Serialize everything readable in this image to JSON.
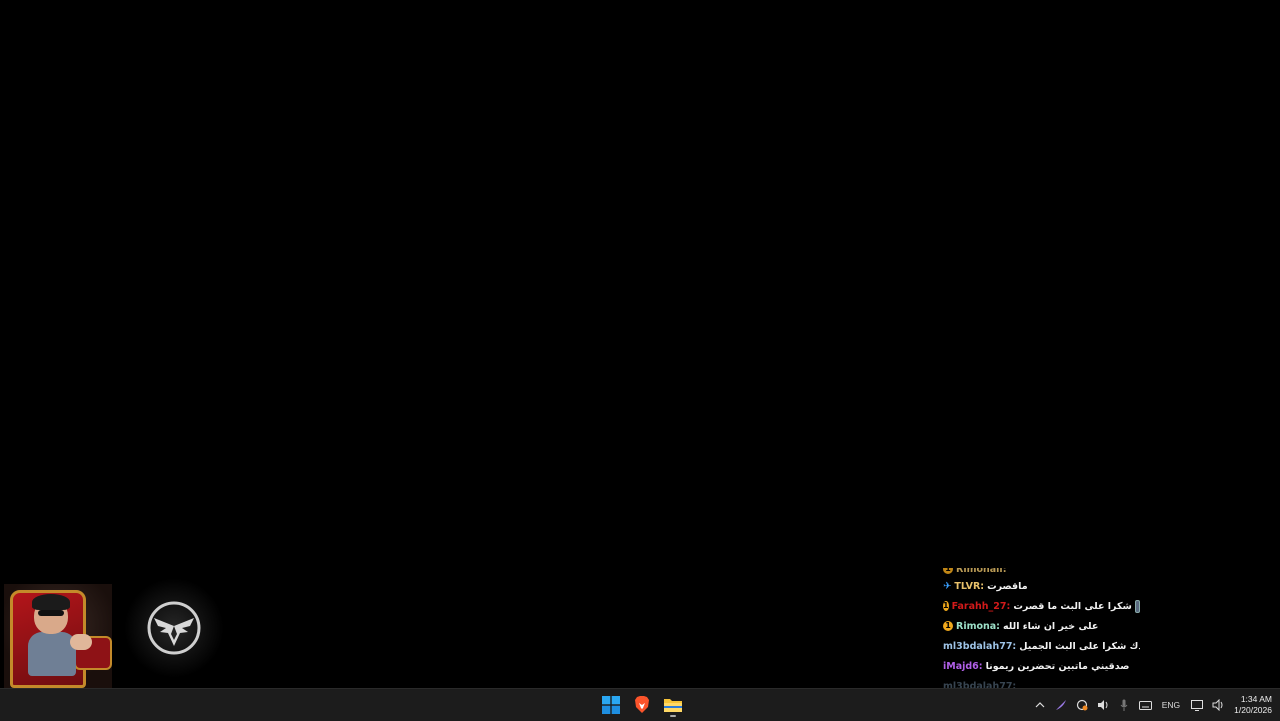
{
  "chat": {
    "messages": [
      {
        "user": "Rimonaاا:",
        "text": "",
        "color": "#e8c16b",
        "badge": "sub",
        "cut": true
      },
      {
        "user": "TLVR:",
        "text": "ماقصرت",
        "color": "#e8c16b",
        "badge": "pin"
      },
      {
        "user": "Farahh_27:",
        "text": "شكرا على البث ما قصرت",
        "color": "#d21a1a",
        "badge": "sub",
        "emote": true
      },
      {
        "user": "Rimona:",
        "text": "على خير ان شاء الله",
        "color": "#9de0c8",
        "badge": "sub"
      },
      {
        "user": "ml3bdalah77:",
        "text": "الله يسعدك شكرا على البث الجميل",
        "color": "#9ec3e6"
      },
      {
        "user": "iMajd6:",
        "text": "صدقيني ماتبين تحضرين ريمونا",
        "color": "#b160e8"
      },
      {
        "user": "ml3bdalah77:",
        "text": "",
        "color": "#9ec3e6",
        "fade": true
      }
    ]
  },
  "taskbar": {
    "apps": [
      {
        "name": "start-button",
        "icon": "windows-icon"
      },
      {
        "name": "brave-browser-button",
        "icon": "brave-icon"
      },
      {
        "name": "file-explorer-button",
        "icon": "folder-icon"
      }
    ],
    "language": "ENG",
    "time": "1:34 AM",
    "date": "1/20/2026"
  },
  "colors": {
    "taskbar_bg": "#1c1c1c",
    "desktop_bg": "#000000"
  }
}
